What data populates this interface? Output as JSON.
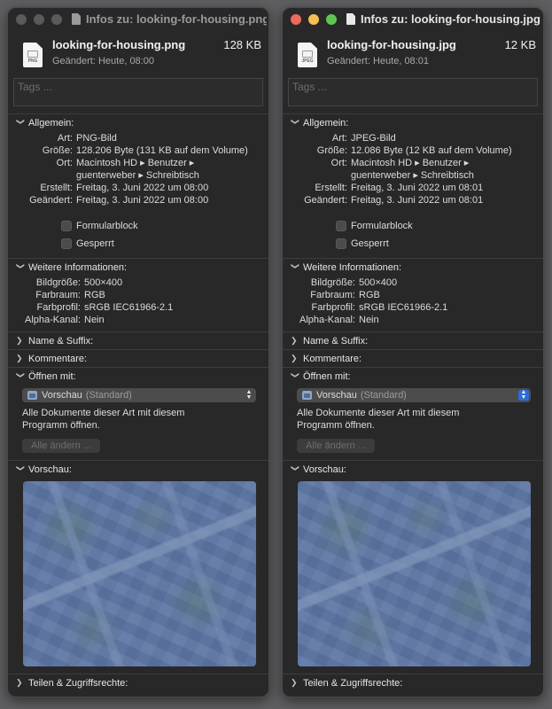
{
  "windows": [
    {
      "title": "Infos zu: looking-for-housing.png",
      "file_name": "looking-for-housing.png",
      "file_size": "128 KB",
      "file_ext": "PNG",
      "modified_line": "Geändert: Heute, 08:00",
      "tags_placeholder": "Tags ...",
      "general": {
        "header": "Allgemein:",
        "rows": [
          {
            "key": "Art:",
            "value": "PNG-Bild"
          },
          {
            "key": "Größe:",
            "value": "128.206 Byte (131 KB auf dem Volume)"
          },
          {
            "key": "Ort:",
            "value": "Macintosh HD ▸ Benutzer ▸"
          },
          {
            "key": "",
            "value": "guenterweber ▸ Schreibtisch"
          },
          {
            "key": "Erstellt:",
            "value": "Freitag, 3. Juni 2022 um 08:00"
          },
          {
            "key": "Geändert:",
            "value": "Freitag, 3. Juni 2022 um 08:00"
          }
        ],
        "checkbox_form": "Formularblock",
        "checkbox_locked": "Gesperrt"
      },
      "more": {
        "header": "Weitere Informationen:",
        "rows": [
          {
            "key": "Bildgröße:",
            "value": "500×400"
          },
          {
            "key": "Farbraum:",
            "value": "RGB"
          },
          {
            "key": "Farbprofil:",
            "value": "sRGB IEC61966-2.1"
          },
          {
            "key": "Alpha-Kanal:",
            "value": "Nein"
          }
        ]
      },
      "name_suffix": "Name & Suffix:",
      "comments": "Kommentare:",
      "open_with": {
        "header": "Öffnen mit:",
        "app": "Vorschau",
        "app_suffix": "(Standard)",
        "description": "Alle Dokumente dieser Art mit diesem Programm öffnen.",
        "button": "Alle ändern ..."
      },
      "preview_header": "Vorschau:",
      "sharing": "Teilen & Zugriffsrechte:"
    },
    {
      "title": "Infos zu: looking-for-housing.jpg",
      "file_name": "looking-for-housing.jpg",
      "file_size": "12 KB",
      "file_ext": "JPEG",
      "modified_line": "Geändert: Heute, 08:01",
      "tags_placeholder": "Tags ...",
      "general": {
        "header": "Allgemein:",
        "rows": [
          {
            "key": "Art:",
            "value": "JPEG-Bild"
          },
          {
            "key": "Größe:",
            "value": "12.086 Byte (12 KB auf dem Volume)"
          },
          {
            "key": "Ort:",
            "value": "Macintosh HD ▸ Benutzer ▸"
          },
          {
            "key": "",
            "value": "guenterweber ▸ Schreibtisch"
          },
          {
            "key": "Erstellt:",
            "value": "Freitag, 3. Juni 2022 um 08:01"
          },
          {
            "key": "Geändert:",
            "value": "Freitag, 3. Juni 2022 um 08:01"
          }
        ],
        "checkbox_form": "Formularblock",
        "checkbox_locked": "Gesperrt"
      },
      "more": {
        "header": "Weitere Informationen:",
        "rows": [
          {
            "key": "Bildgröße:",
            "value": "500×400"
          },
          {
            "key": "Farbraum:",
            "value": "RGB"
          },
          {
            "key": "Farbprofil:",
            "value": "sRGB IEC61966-2.1"
          },
          {
            "key": "Alpha-Kanal:",
            "value": "Nein"
          }
        ]
      },
      "name_suffix": "Name & Suffix:",
      "comments": "Kommentare:",
      "open_with": {
        "header": "Öffnen mit:",
        "app": "Vorschau",
        "app_suffix": "(Standard)",
        "description": "Alle Dokumente dieser Art mit diesem Programm öffnen.",
        "button": "Alle ändern ..."
      },
      "preview_header": "Vorschau:",
      "sharing": "Teilen & Zugriffsrechte:"
    }
  ],
  "colors": {
    "window_bg": "#282828",
    "close": "#ed6a5e",
    "minimize": "#f5bf4f",
    "zoom": "#61c554",
    "accent": "#2f6bd8"
  }
}
